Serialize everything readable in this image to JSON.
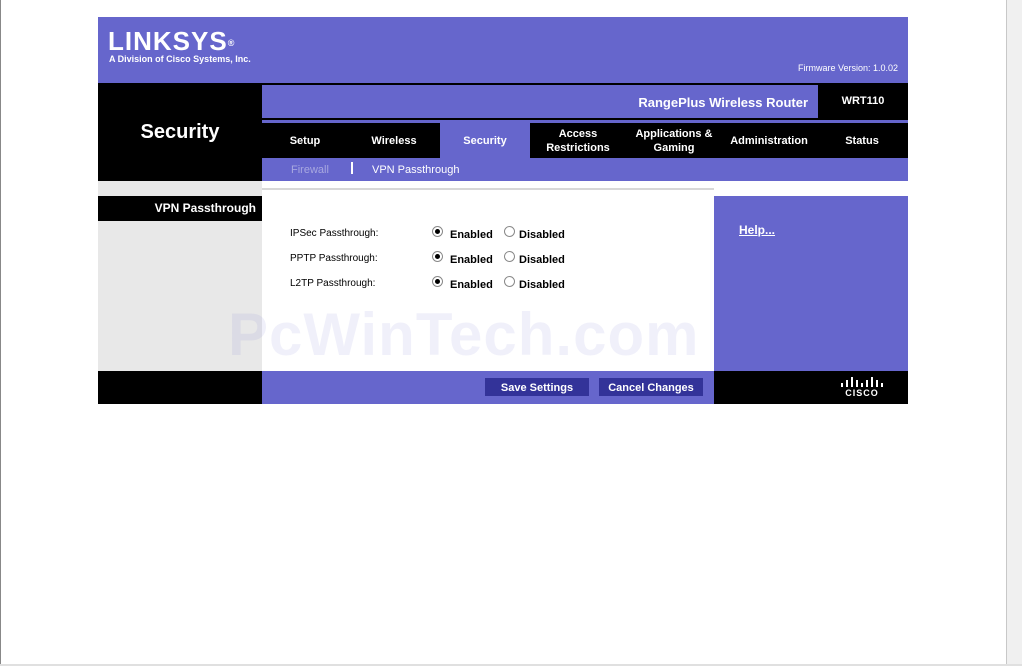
{
  "header": {
    "brand": "LINKSYS",
    "brand_mark": "®",
    "tagline": "A Division of Cisco Systems, Inc.",
    "firmware": "Firmware Version: 1.0.02"
  },
  "product": {
    "name": "RangePlus Wireless Router",
    "model": "WRT110"
  },
  "section_title": "Security",
  "tabs": [
    {
      "label": "Setup"
    },
    {
      "label": "Wireless"
    },
    {
      "label": "Security",
      "active": true
    },
    {
      "label": "Access\nRestrictions"
    },
    {
      "label": "Applications &\nGaming"
    },
    {
      "label": "Administration"
    },
    {
      "label": "Status"
    }
  ],
  "subnav": {
    "items": [
      "Firewall",
      "VPN Passthrough"
    ],
    "active": "VPN Passthrough"
  },
  "sidebar": {
    "heading": "VPN Passthrough"
  },
  "settings": [
    {
      "label": "IPSec Passthrough:",
      "enabled": "Enabled",
      "disabled": "Disabled",
      "value": "Enabled"
    },
    {
      "label": "PPTP Passthrough:",
      "enabled": "Enabled",
      "disabled": "Disabled",
      "value": "Enabled"
    },
    {
      "label": "L2TP Passthrough:",
      "enabled": "Enabled",
      "disabled": "Disabled",
      "value": "Enabled"
    }
  ],
  "help": {
    "label": "Help..."
  },
  "watermark": "PcWinTech.com",
  "buttons": {
    "save": "Save Settings",
    "cancel": "Cancel Changes"
  },
  "footer_logo": {
    "text": "CISCO",
    "icon": "cisco-bars-icon"
  },
  "colors": {
    "brand": "#6666cc",
    "button": "#333399",
    "black": "#000000"
  }
}
